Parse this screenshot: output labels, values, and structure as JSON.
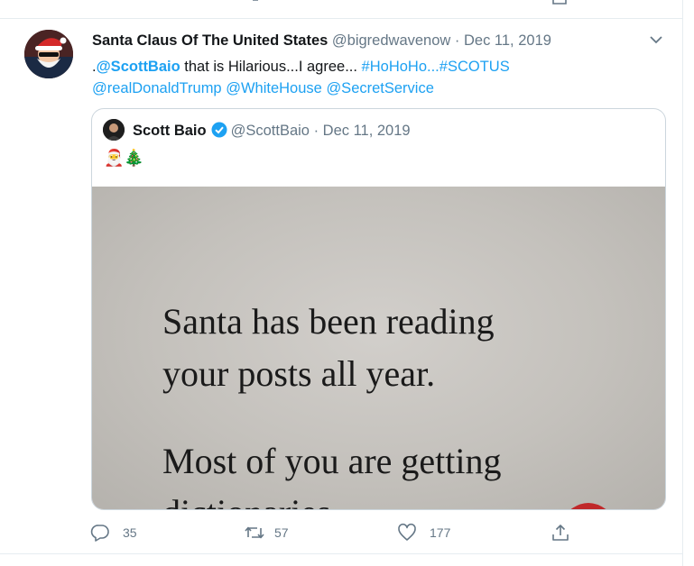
{
  "tweet": {
    "author_name": "Santa Claus Of The United States",
    "handle": "@bigredwavenow",
    "separator": "·",
    "date": "Dec 11, 2019",
    "text": {
      "lead": ".",
      "mention_1": "@ScottBaio",
      "body": " that is Hilarious...I agree... ",
      "hashtag_1": "#HoHoHo",
      "ellipsis": "...",
      "hashtag_2": "#SCOTUS",
      "mention_2": "@realDonaldTrump",
      "mention_3": "@WhiteHouse",
      "mention_4": "@SecretService"
    }
  },
  "quoted_tweet": {
    "author_name": "Scott Baio",
    "handle": "@ScottBaio",
    "separator": "·",
    "date": "Dec 11, 2019",
    "emojis": "🎅🎄",
    "image_text": {
      "line_1": "Santa has been reading",
      "line_2": "your posts all year.",
      "line_3": "Most of you are getting",
      "line_4": "dictionaries."
    }
  },
  "actions": {
    "reply_count": "35",
    "retweet_count": "57",
    "like_count": "177"
  },
  "colors": {
    "link": "#1da1f2",
    "muted": "#657786",
    "border": "#e6ecf0",
    "verified": "#1da1f2"
  },
  "icons": [
    "reply-icon",
    "retweet-icon",
    "like-icon",
    "share-icon",
    "caret-down-icon",
    "verified-badge-icon"
  ]
}
